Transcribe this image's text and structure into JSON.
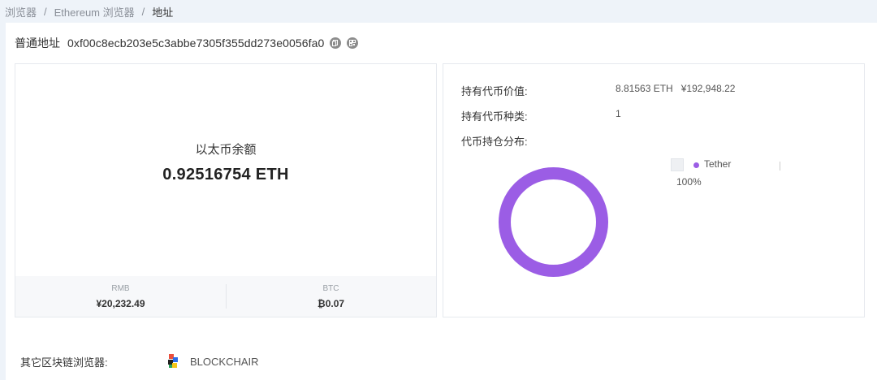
{
  "breadcrumb": {
    "items": [
      "浏览器",
      "Ethereum 浏览器"
    ],
    "separator": "/",
    "current": "地址"
  },
  "address": {
    "label": "普通地址",
    "value": "0xf00c8ecb203e5c3abbe7305f355dd273e0056fa0"
  },
  "balance": {
    "title": "以太币余额",
    "value": "0.92516754 ETH",
    "rmb_label": "RMB",
    "rmb_value": "¥20,232.49",
    "btc_label": "BTC",
    "btc_value": "₿0.07"
  },
  "holdings": {
    "value_label": "持有代币价值:",
    "value_eth": "8.81563 ETH",
    "value_cny": "¥192,948.22",
    "types_label": "持有代币种类:",
    "types_count": "1",
    "dist_label": "代币持仓分布:"
  },
  "chart_data": {
    "type": "pie",
    "series": [
      {
        "name": "Tether",
        "values": [
          100
        ]
      }
    ],
    "labels": [
      "Tether"
    ],
    "percent_label": "100%",
    "color": "#9b5de5"
  },
  "other_explorers": {
    "label": "其它区块链浏览器:",
    "items": [
      {
        "name": "BLOCKCHAIR",
        "icon": "blockchair-logo"
      }
    ]
  }
}
